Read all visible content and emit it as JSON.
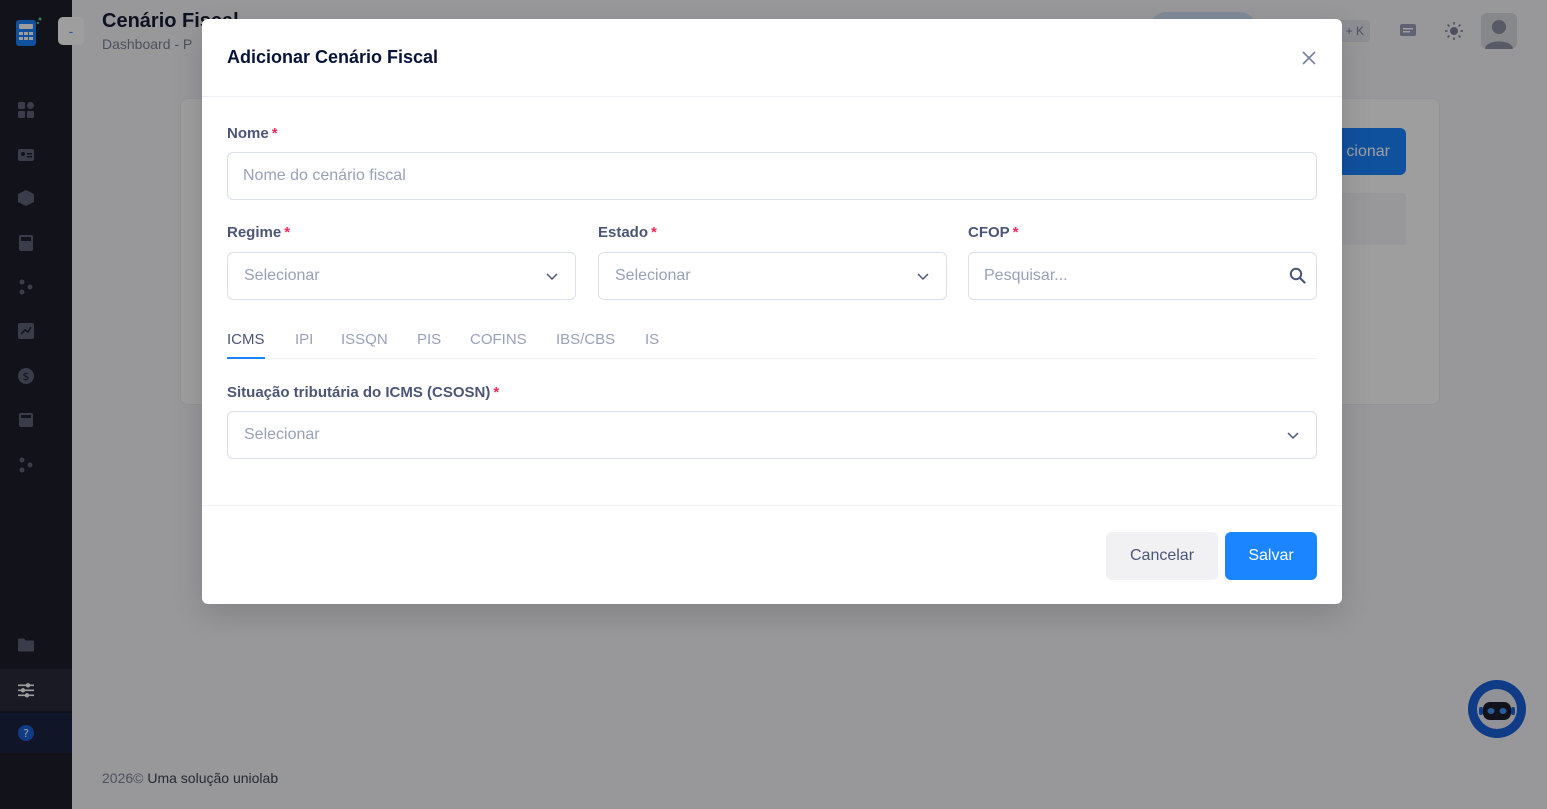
{
  "header": {
    "title": "Cenário Fiscal",
    "breadcrumb": "Dashboard  -  P",
    "shortcut": "+ K"
  },
  "background": {
    "add_button_label": "cionar"
  },
  "footer": {
    "year": "2026©",
    "text": " Uma solução uniolab"
  },
  "modal": {
    "title": "Adicionar Cenário Fiscal",
    "nome": {
      "label": "Nome",
      "required": "*",
      "placeholder": "Nome do cenário fiscal",
      "value": ""
    },
    "regime": {
      "label": "Regime",
      "required": "*",
      "value": "Selecionar"
    },
    "estado": {
      "label": "Estado",
      "required": "*",
      "value": "Selecionar"
    },
    "cfop": {
      "label": "CFOP",
      "required": "*",
      "placeholder": "Pesquisar..."
    },
    "tabs": [
      {
        "label": "ICMS",
        "active": true
      },
      {
        "label": "IPI"
      },
      {
        "label": "ISSQN"
      },
      {
        "label": "PIS"
      },
      {
        "label": "COFINS"
      },
      {
        "label": "IBS/CBS"
      },
      {
        "label": "IS"
      }
    ],
    "csosn": {
      "label": "Situação tributária do ICMS (CSOSN)",
      "required": "*",
      "value": "Selecionar"
    },
    "cancel_label": "Cancelar",
    "save_label": "Salvar"
  },
  "colors": {
    "primary": "#1b84ff",
    "required": "#f8285a",
    "sidebar": "#1e1e2d"
  }
}
